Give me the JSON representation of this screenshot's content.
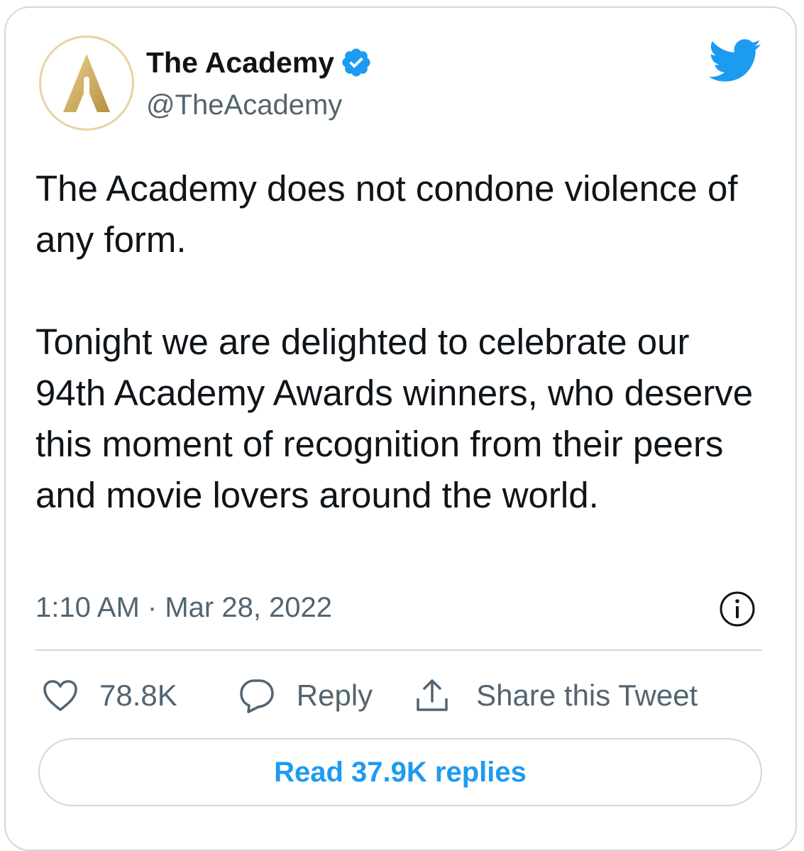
{
  "author": {
    "display_name": "The Academy",
    "handle": "@TheAcademy",
    "verified": true,
    "avatar_icon": "oscar-statuette-logo"
  },
  "platform_icon": "twitter-bird-icon",
  "tweet": {
    "paragraphs": [
      "The Academy does not condone violence of any form.",
      "Tonight we are delighted to celebrate our 94th Academy Awards winners, who deserve this moment of recognition from their peers and movie lovers around the world."
    ],
    "time": "1:10 AM",
    "separator": "·",
    "date": "Mar 28, 2022"
  },
  "actions": {
    "like_count": "78.8K",
    "reply_label": "Reply",
    "share_label": "Share this Tweet"
  },
  "read_replies_label": "Read 37.9K replies",
  "colors": {
    "accent": "#1d9bf0",
    "text": "#0f1419",
    "secondary_text": "#536471",
    "border": "#cfd9de",
    "gold": "#c9a659"
  }
}
